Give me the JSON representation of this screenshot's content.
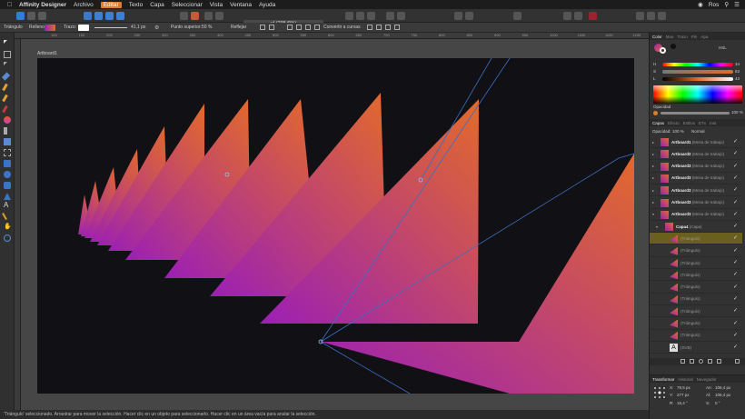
{
  "menubar": {
    "app_name": "Affinity Designer",
    "items": [
      "Archivo",
      "Editar",
      "Texto",
      "Capa",
      "Seleccionar",
      "Vista",
      "Ventana",
      "Ayuda"
    ],
    "active_item": "Editar",
    "user": "Ros"
  },
  "toolbar": {
    "document_title": "y! (235.6%)"
  },
  "context_bar": {
    "selection_type": "Triángulo",
    "fill_label": "Relleno",
    "stroke_label": "Trazo:",
    "stroke_width": "41,1 px",
    "point_label": "Punto superior:",
    "point_value": "50 %",
    "reflect_label": "Reflejar",
    "convert_label": "Convertir a curvas"
  },
  "rulers": {
    "top_ticks": [
      "100",
      "150",
      "200",
      "250",
      "300",
      "350",
      "400",
      "450",
      "500",
      "550",
      "600",
      "650",
      "700",
      "750",
      "800",
      "850",
      "900",
      "950",
      "1000",
      "1050",
      "1100",
      "1150",
      "1200"
    ]
  },
  "canvas": {
    "artboard_label": "Artboard1",
    "colors": {
      "background": "#111015",
      "gradient_start": "#9b1fb5",
      "gradient_end": "#e36a2a",
      "guide": "#3a6fbf"
    }
  },
  "status_bar": {
    "text": "'Triángulo' seleccionado. Arrastrar para mover la selección. Hacer clic en un objeto para seleccionarlo. Hacer clic en un área vacía para anular la selección."
  },
  "color_panel": {
    "tabs": [
      "Color",
      "Mue",
      "Trazo",
      "Pin",
      "Apa"
    ],
    "active_tab": "Color",
    "mode": "HSL",
    "sliders": [
      {
        "key": "H",
        "value": "34"
      },
      {
        "key": "S",
        "value": "83"
      },
      {
        "key": "L",
        "value": "43"
      }
    ],
    "opacity_label": "Opacidad",
    "opacity_value": "100 %"
  },
  "layers_panel": {
    "tabs": [
      "Capas",
      "Efecto",
      "Estilos",
      "ETx",
      "Inst"
    ],
    "active_tab": "Capas",
    "opacity_label": "Opacidad:",
    "opacity_value": "100 %",
    "blend_mode": "Normal",
    "layers": [
      {
        "name": "Artboard1",
        "type": "(Mesa de trabajo)",
        "indent": 0,
        "expanded": false,
        "selected": false
      },
      {
        "name": "Artboard2",
        "type": "(Mesa de trabajo)",
        "indent": 0,
        "expanded": false,
        "selected": false
      },
      {
        "name": "Artboard3",
        "type": "(Mesa de trabajo)",
        "indent": 0,
        "expanded": false,
        "selected": false
      },
      {
        "name": "Artboard3",
        "type": "(Mesa de trabajo)",
        "indent": 0,
        "expanded": false,
        "selected": false
      },
      {
        "name": "Artboard3",
        "type": "(Mesa de trabajo)",
        "indent": 0,
        "expanded": false,
        "selected": false
      },
      {
        "name": "Artboard3",
        "type": "(Mesa de trabajo)",
        "indent": 0,
        "expanded": false,
        "selected": false
      },
      {
        "name": "Artboard3",
        "type": "(Mesa de trabajo)",
        "indent": 0,
        "expanded": true,
        "selected": false
      },
      {
        "name": "Capa4",
        "type": "(Capa)",
        "indent": 1,
        "expanded": true,
        "selected": false
      },
      {
        "name": "",
        "type": "(Triángulo)",
        "indent": 2,
        "expanded": false,
        "selected": true
      },
      {
        "name": "",
        "type": "(Triángulo)",
        "indent": 2,
        "expanded": false,
        "selected": false
      },
      {
        "name": "",
        "type": "(Triángulo)",
        "indent": 2,
        "expanded": false,
        "selected": false
      },
      {
        "name": "",
        "type": "(Triángulo)",
        "indent": 2,
        "expanded": false,
        "selected": false
      },
      {
        "name": "",
        "type": "(Triángulo)",
        "indent": 2,
        "expanded": false,
        "selected": false
      },
      {
        "name": "",
        "type": "(Triángulo)",
        "indent": 2,
        "expanded": false,
        "selected": false
      },
      {
        "name": "",
        "type": "(Triángulo)",
        "indent": 2,
        "expanded": false,
        "selected": false
      },
      {
        "name": "",
        "type": "(Triángulo)",
        "indent": 2,
        "expanded": false,
        "selected": false
      },
      {
        "name": "",
        "type": "(Triángulo)",
        "indent": 2,
        "expanded": false,
        "selected": false
      },
      {
        "name": "",
        "type": "(SVB)",
        "indent": 2,
        "expanded": false,
        "selected": false
      }
    ]
  },
  "transform_panel": {
    "tabs": [
      "Transformar",
      "Historial",
      "Navegador"
    ],
    "active_tab": "Transformar",
    "x": "79,5 px",
    "y": "277 px",
    "w": "106,4 px",
    "h": "106,4 px",
    "r": "16,4 °",
    "s": "0 °"
  }
}
